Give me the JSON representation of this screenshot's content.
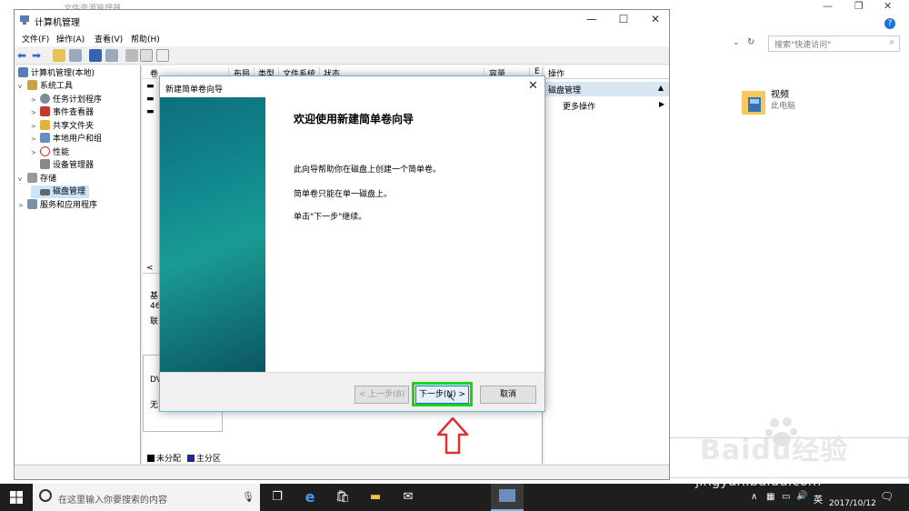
{
  "background": {
    "title": "文件资源管理器",
    "search_placeholder": "搜索\"快速访问\"",
    "folder_name": "视频",
    "folder_location": "此电脑"
  },
  "window": {
    "title": "计算机管理",
    "minimize": "—",
    "maximize": "☐",
    "close": "✕"
  },
  "menu": [
    "文件(F)",
    "操作(A)",
    "查看(V)",
    "帮助(H)"
  ],
  "tree": [
    {
      "label": "计算机管理(本地)",
      "level": 0,
      "arrow": ""
    },
    {
      "label": "系统工具",
      "level": 1,
      "arrow": "v"
    },
    {
      "label": "任务计划程序",
      "level": 2,
      "arrow": ">"
    },
    {
      "label": "事件查看器",
      "level": 2,
      "arrow": ">"
    },
    {
      "label": "共享文件夹",
      "level": 2,
      "arrow": ">"
    },
    {
      "label": "本地用户和组",
      "level": 2,
      "arrow": ">"
    },
    {
      "label": "性能",
      "level": 2,
      "arrow": ">"
    },
    {
      "label": "设备管理器",
      "level": 2,
      "arrow": ""
    },
    {
      "label": "存储",
      "level": 1,
      "arrow": "v"
    },
    {
      "label": "磁盘管理",
      "level": 2,
      "arrow": ""
    },
    {
      "label": "服务和应用程序",
      "level": 1,
      "arrow": ">"
    }
  ],
  "columns": [
    "卷",
    "布局",
    "类型",
    "文件系统",
    "状态",
    "容量",
    "E"
  ],
  "disk_fragments": [
    "基",
    "46",
    "联",
    "DV",
    "无"
  ],
  "legend": {
    "unallocated": "未分配",
    "primary": "主分区"
  },
  "actions": {
    "header": "操作",
    "selected": "磁盘管理",
    "more": "更多操作"
  },
  "wizard": {
    "title": "新建简单卷向导",
    "heading": "欢迎使用新建简单卷向导",
    "line1": "此向导帮助你在磁盘上创建一个简单卷。",
    "line2": "简单卷只能在单一磁盘上。",
    "line3": "单击\"下一步\"继续。",
    "back": "< 上一步(B)",
    "next": "下一步(N) >",
    "cancel": "取消"
  },
  "taskbar": {
    "search": "在这里输入你要搜索的内容",
    "ime": "英",
    "date": "2017/10/12"
  },
  "watermark": {
    "logo": "Baidu经验",
    "url": "jingyan.baidu.com"
  },
  "colors": {
    "highlight": "#1cd31c",
    "arrow": "#e03030",
    "banner": "#118a8f",
    "selection": "#d9e7f5"
  }
}
